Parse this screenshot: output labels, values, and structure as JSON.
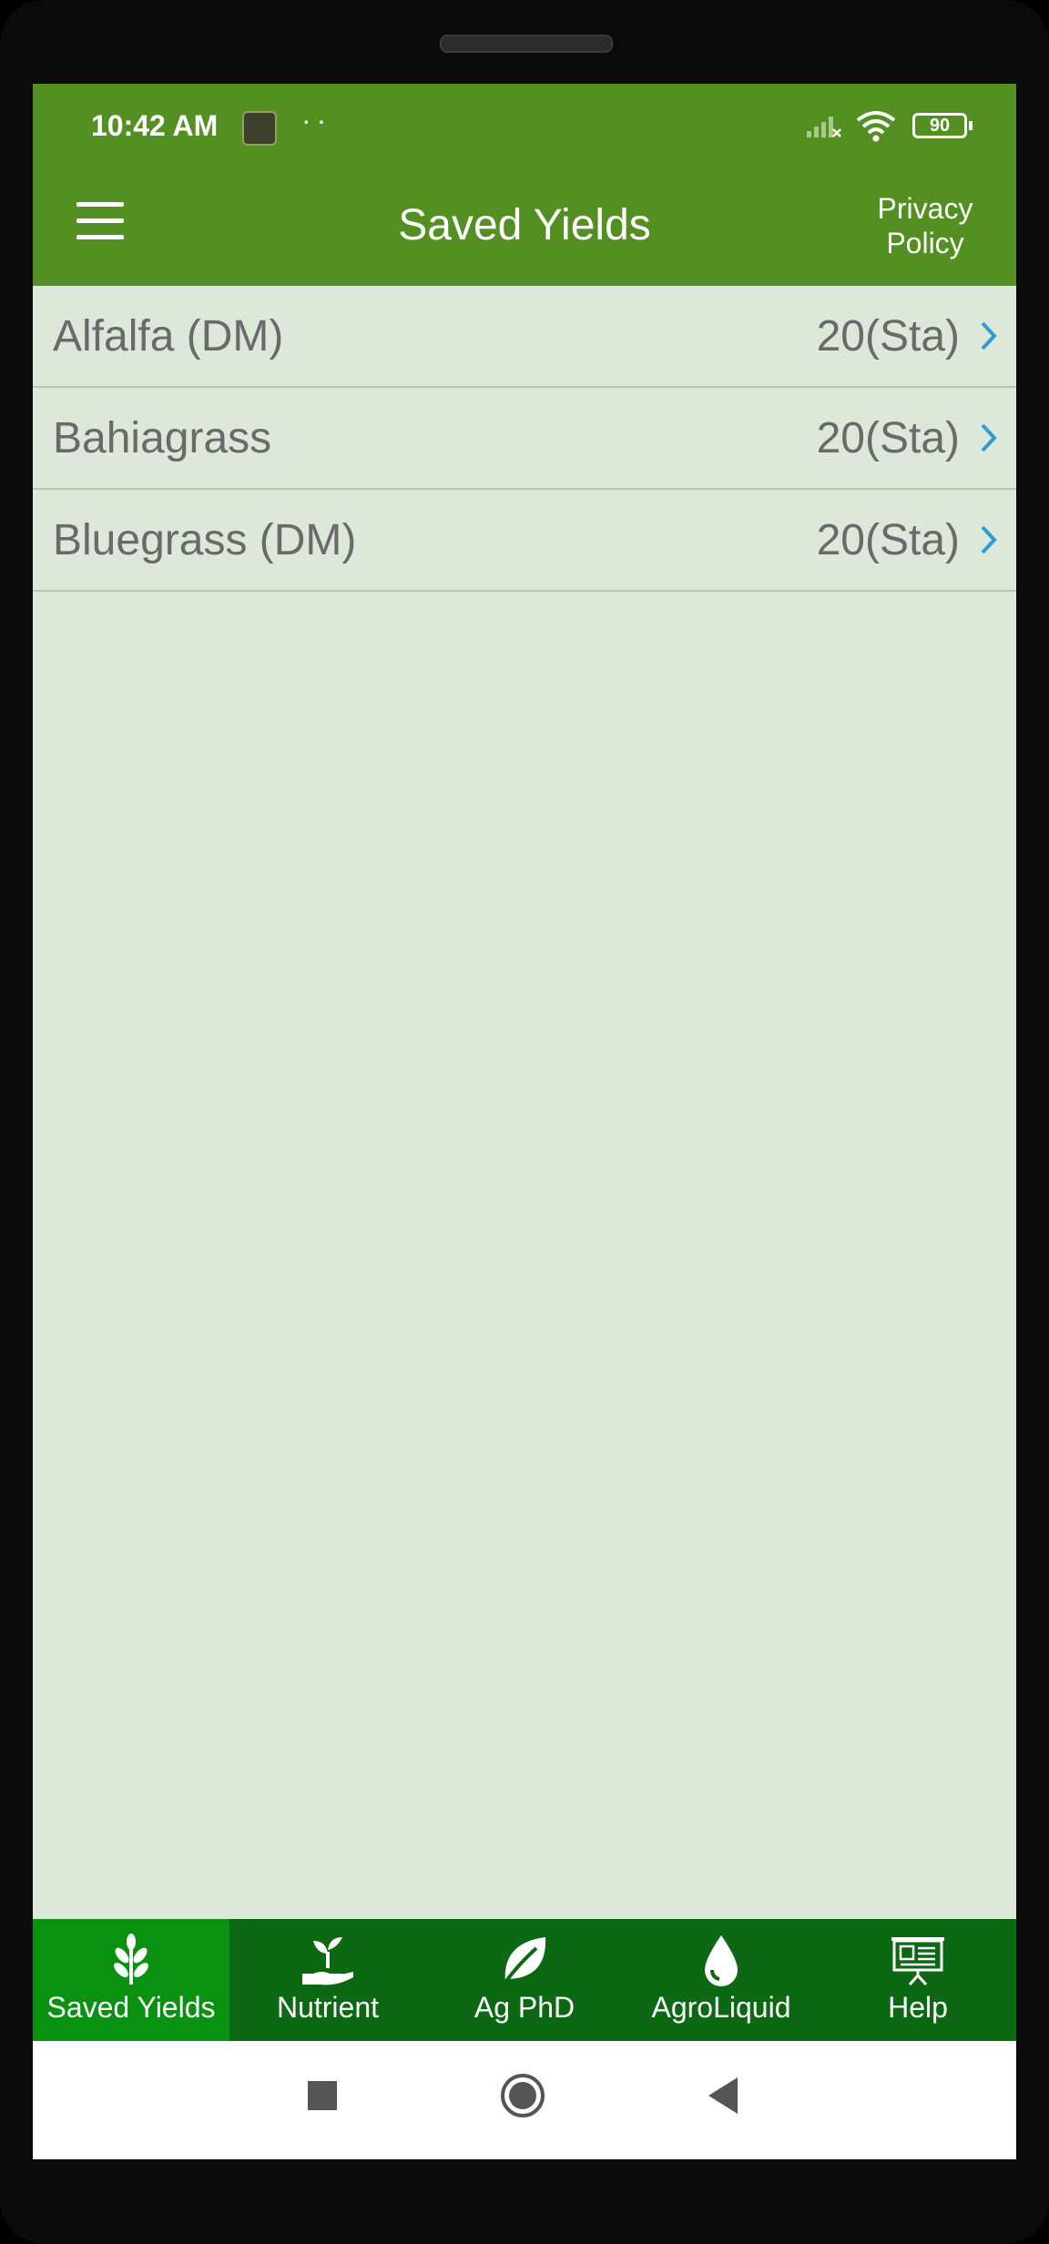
{
  "status_bar": {
    "time": "10:42 AM",
    "dots": "··",
    "battery": "90"
  },
  "app_bar": {
    "title": "Saved Yields",
    "privacy_label_1": "Privacy",
    "privacy_label_2": "Policy"
  },
  "list": {
    "items": [
      {
        "name": "Alfalfa (DM)",
        "value": "20(Sta)"
      },
      {
        "name": "Bahiagrass",
        "value": "20(Sta)"
      },
      {
        "name": "Bluegrass (DM)",
        "value": "20(Sta)"
      }
    ]
  },
  "bottom_nav": {
    "items": [
      {
        "label": "Saved Yields",
        "icon": "wheat-icon",
        "active": true
      },
      {
        "label": "Nutrient",
        "icon": "sprout-hand-icon",
        "active": false
      },
      {
        "label": "Ag PhD",
        "icon": "leaf-icon",
        "active": false
      },
      {
        "label": "AgroLiquid",
        "icon": "droplet-icon",
        "active": false
      },
      {
        "label": "Help",
        "icon": "presentation-board-icon",
        "active": false
      }
    ]
  },
  "colors": {
    "app_bar": "#548f22",
    "background": "#dde7da",
    "nav_bar": "#0c6813",
    "nav_active": "#0b9111",
    "chevron": "#2a9fd6"
  }
}
